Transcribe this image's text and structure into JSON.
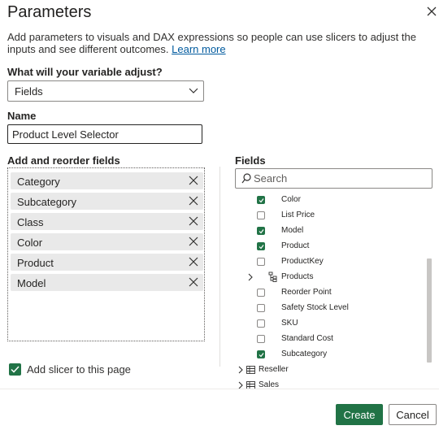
{
  "dialog": {
    "title": "Parameters",
    "description": "Add parameters to visuals and DAX expressions so people can use slicers to adjust the inputs and see different outcomes.",
    "learn_more": "Learn more"
  },
  "adjust": {
    "label": "What will your variable adjust?",
    "value": "Fields"
  },
  "name": {
    "label": "Name",
    "value": "Product Level Selector"
  },
  "reorder": {
    "label": "Add and reorder fields",
    "items": [
      "Category",
      "Subcategory",
      "Class",
      "Color",
      "Product",
      "Model"
    ]
  },
  "fields": {
    "label": "Fields",
    "search_placeholder": "Search",
    "tree": [
      {
        "label": "Color",
        "type": "field",
        "checked": true
      },
      {
        "label": "List Price",
        "type": "field",
        "checked": false
      },
      {
        "label": "Model",
        "type": "field",
        "checked": true
      },
      {
        "label": "Product",
        "type": "field",
        "checked": true
      },
      {
        "label": "ProductKey",
        "type": "field",
        "checked": false
      },
      {
        "label": "Products",
        "type": "hierarchy",
        "checked": false
      },
      {
        "label": "Reorder Point",
        "type": "field",
        "checked": false
      },
      {
        "label": "Safety Stock Level",
        "type": "field",
        "checked": false
      },
      {
        "label": "SKU",
        "type": "field",
        "checked": false
      },
      {
        "label": "Standard Cost",
        "type": "field",
        "checked": false
      },
      {
        "label": "Subcategory",
        "type": "field",
        "checked": true
      },
      {
        "label": "Reseller",
        "type": "table",
        "checked": false
      },
      {
        "label": "Sales",
        "type": "table",
        "checked": false
      }
    ]
  },
  "slicer": {
    "label": "Add slicer to this page",
    "checked": true
  },
  "buttons": {
    "create": "Create",
    "cancel": "Cancel"
  },
  "colors": {
    "accent": "#217346",
    "link": "#005a9e",
    "chip": "#e9e9e9"
  }
}
